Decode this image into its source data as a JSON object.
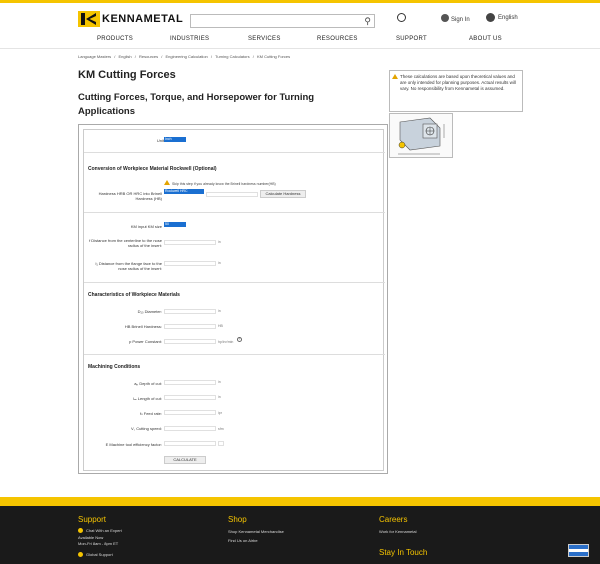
{
  "header": {
    "logo_text": "KENNAMETAL",
    "search_placeholder": "",
    "country_label": "",
    "sign_in": "Sign In",
    "language": "English"
  },
  "nav": {
    "items": [
      "PRODUCTS",
      "INDUSTRIES",
      "SERVICES",
      "RESOURCES",
      "SUPPORT",
      "ABOUT US"
    ]
  },
  "breadcrumbs": [
    "Language Masters",
    "/",
    "English",
    "/",
    "Resources",
    "/",
    "Engineering Calculation",
    "/",
    "Turning Calculators",
    "/",
    "KM Cutting Forces"
  ],
  "page": {
    "title": "KM Cutting Forces",
    "subtitle": "Cutting Forces, Torque, and Horsepower for Turning Applications"
  },
  "notice": {
    "text": "These calculations are based upon theoretical values and are only intended for planning purposes. Actual results will vary. No responsibility from Kennametal is assumed."
  },
  "form": {
    "unit_label": "Unit",
    "unit_value": "Inch",
    "conversion_title": "Conversion of Workpiece Material Rockwell (Optional)",
    "skip_hint": "Skip this step if you already know the Brinell hardness number(HB)",
    "hardness_label": "Hardness HRB OR HRC into Brinell Hardness (HB)",
    "hardness_select": "Rockwell HRC",
    "calc_hardness_btn": "Calculate Hardness",
    "km_size_label": "KM input KM size",
    "km_size_value": "50",
    "f_dist_label": "f Distance from the centerline to the nose radius of the insert:",
    "l1_dist_label": "l₁ Distance from the flange face to the nose radius of the insert:",
    "unit_in": "in",
    "materials_title": "Characteristics of Workpiece Materials",
    "diameter_label": "D₁₀ Diameter:",
    "brinell_label": "HB Brinell Hardness:",
    "brinell_unit": "HB",
    "power_label": "p Power Constant:",
    "power_unit": "hp/in³/min",
    "machining_title": "Machining Conditions",
    "depth_label": "aₚ Depth of cut:",
    "length_label": "lₘ Length of cut:",
    "feed_label": "fₙ Feed rate:",
    "feed_unit": "ipr",
    "speed_label": "V꜀ Cutting speed:",
    "speed_unit": "sfm",
    "efficiency_label": "E Machine tool efficiency factor:",
    "calculate_btn": "CALCULATE"
  },
  "footer": {
    "support_title": "Support",
    "support_items": [
      "Chat With an Expert",
      "Available Now",
      "Mon-Fri 8am - 8pm ET",
      "Global Support"
    ],
    "shop_title": "Shop",
    "shop_items": [
      "Shop Kennametal Merchandise",
      "Find Us on Airbe"
    ],
    "careers_title": "Careers",
    "careers_items": [
      "Work for Kennametal"
    ],
    "stay_title": "Stay In Touch"
  },
  "colors": {
    "brand_yellow": "#f5c400",
    "select_blue": "#1a6fd1",
    "footer_bg": "#1a1a1a"
  }
}
